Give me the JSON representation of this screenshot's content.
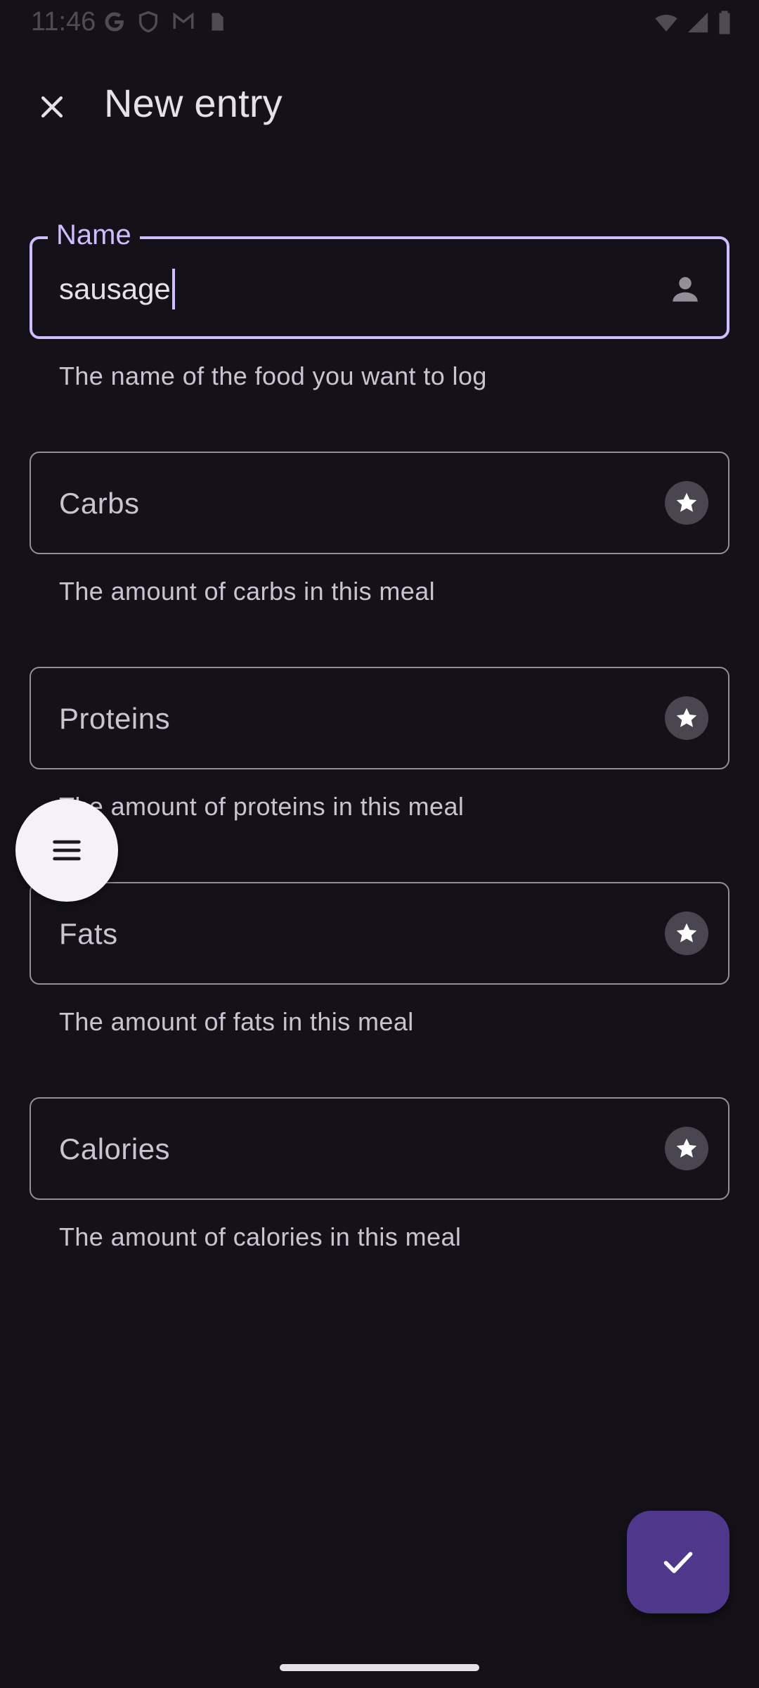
{
  "status_bar": {
    "time": "11:46"
  },
  "app_bar": {
    "title": "New entry"
  },
  "form": {
    "name": {
      "label": "Name",
      "value": "sausage",
      "helper": "The name of the food you want to log"
    },
    "carbs": {
      "placeholder": "Carbs",
      "helper": "The amount of carbs in this meal"
    },
    "proteins": {
      "placeholder": "Proteins",
      "helper": "The amount of proteins in this meal"
    },
    "fats": {
      "placeholder": "Fats",
      "helper": "The amount of fats in this meal"
    },
    "calories": {
      "placeholder": "Calories",
      "helper": "The amount of calories in this meal"
    }
  },
  "icons": {
    "close": "close-icon",
    "person": "person-icon",
    "star": "star-icon",
    "menu": "menu-icon",
    "check": "check-icon"
  },
  "colors": {
    "background": "#141218",
    "accent": "#d0bcff",
    "fab": "#4f378b",
    "outline": "#938f99"
  }
}
